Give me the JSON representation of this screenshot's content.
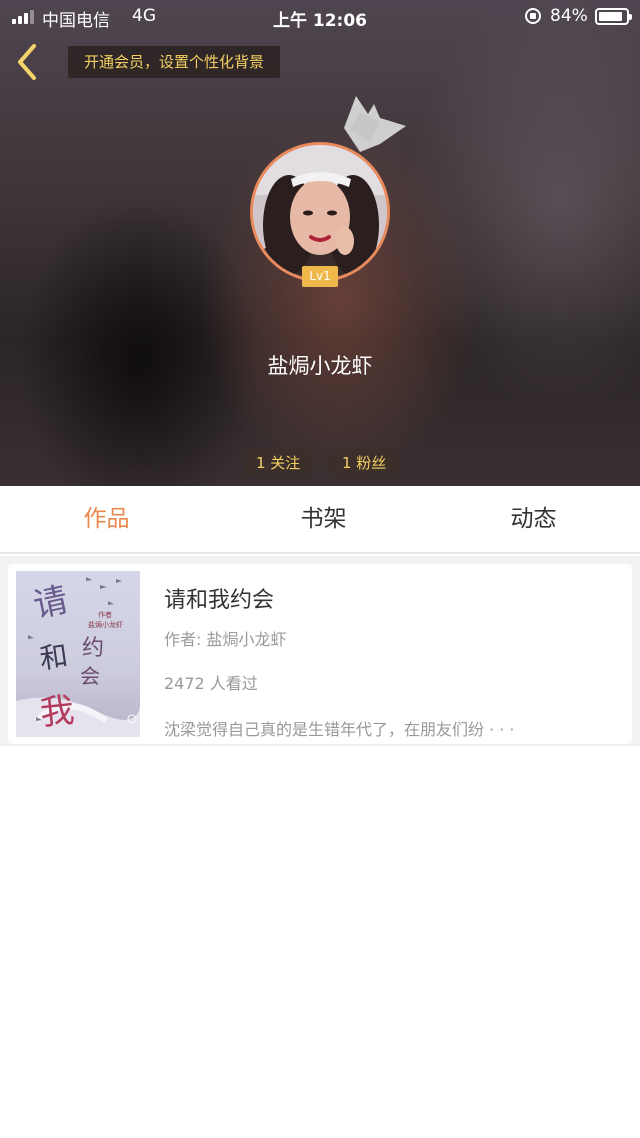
{
  "status_bar": {
    "carrier": "中国电信",
    "network": "4G",
    "time": "上午 12:06",
    "battery": "84%"
  },
  "header": {
    "vip_banner": "开通会员，设置个性化背景"
  },
  "profile": {
    "level": "Lv1",
    "username": "盐焗小龙虾",
    "following": "1 关注",
    "followers": "1 粉丝"
  },
  "tabs": [
    {
      "label": "作品",
      "active": true
    },
    {
      "label": "书架",
      "active": false
    },
    {
      "label": "动态",
      "active": false
    }
  ],
  "books": [
    {
      "title": "请和我约会",
      "author": "作者: 盐焗小龙虾",
      "reads": "2472 人看过",
      "summary": "沈梁觉得自己真的是生错年代了，在朋友们纷 · · ·",
      "cover": {
        "title_chars": [
          "请",
          "和",
          "我",
          "约",
          "会"
        ],
        "label": "作者",
        "author": "盐焗小龙虾"
      }
    }
  ],
  "colors": {
    "accent": "#e98a4c",
    "gold_text": "#f3cf63",
    "avatar_ring": "#e98a5c"
  }
}
